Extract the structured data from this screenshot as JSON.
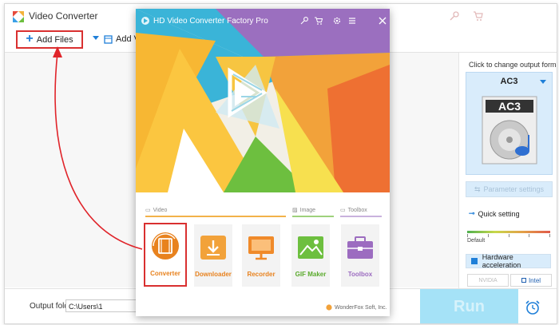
{
  "main": {
    "title": "Video Converter",
    "add_files_label": "Add Files",
    "add_video_label": "Add Vid",
    "output_folder_label": "Output folder:",
    "output_folder_value": "C:\\Users\\1",
    "run_label": "Run"
  },
  "right_panel": {
    "hint": "Click to change output format:",
    "format_name": "AC3",
    "format_icon_text": "AC3",
    "parameter_settings": "Parameter settings",
    "quick_setting": "Quick setting",
    "default_label": "Default",
    "hardware_acceleration": "Hardware acceleration",
    "nvidia": "NVIDIA",
    "intel": "Intel"
  },
  "pro_window": {
    "title": "HD Video Converter Factory Pro",
    "sections": {
      "video": "Video",
      "image": "Image",
      "toolbox": "Toolbox"
    },
    "tiles": [
      {
        "label": "Converter",
        "color": "#e8821e"
      },
      {
        "label": "Downloader",
        "color": "#e8821e"
      },
      {
        "label": "Recorder",
        "color": "#e8821e"
      },
      {
        "label": "GIF Maker",
        "color": "#6dbf3f"
      },
      {
        "label": "Toolbox",
        "color": "#9c6cc0"
      }
    ],
    "footer": "WonderFox Soft, Inc."
  },
  "colors": {
    "accent_blue": "#1f7fd8",
    "highlight_red": "#d93030",
    "run_bg": "#a5e2f7",
    "panel_blue": "#d9ecfb"
  },
  "icons": [
    "app-logo-icon",
    "key-icon",
    "cart-icon",
    "gear-icon",
    "menu-icon",
    "close-icon",
    "plus-icon",
    "add-video-icon",
    "alarm-clock-icon",
    "disc-icon",
    "quick-setting-icon",
    "film-icon",
    "download-icon",
    "monitor-icon",
    "image-icon",
    "toolbox-icon"
  ]
}
